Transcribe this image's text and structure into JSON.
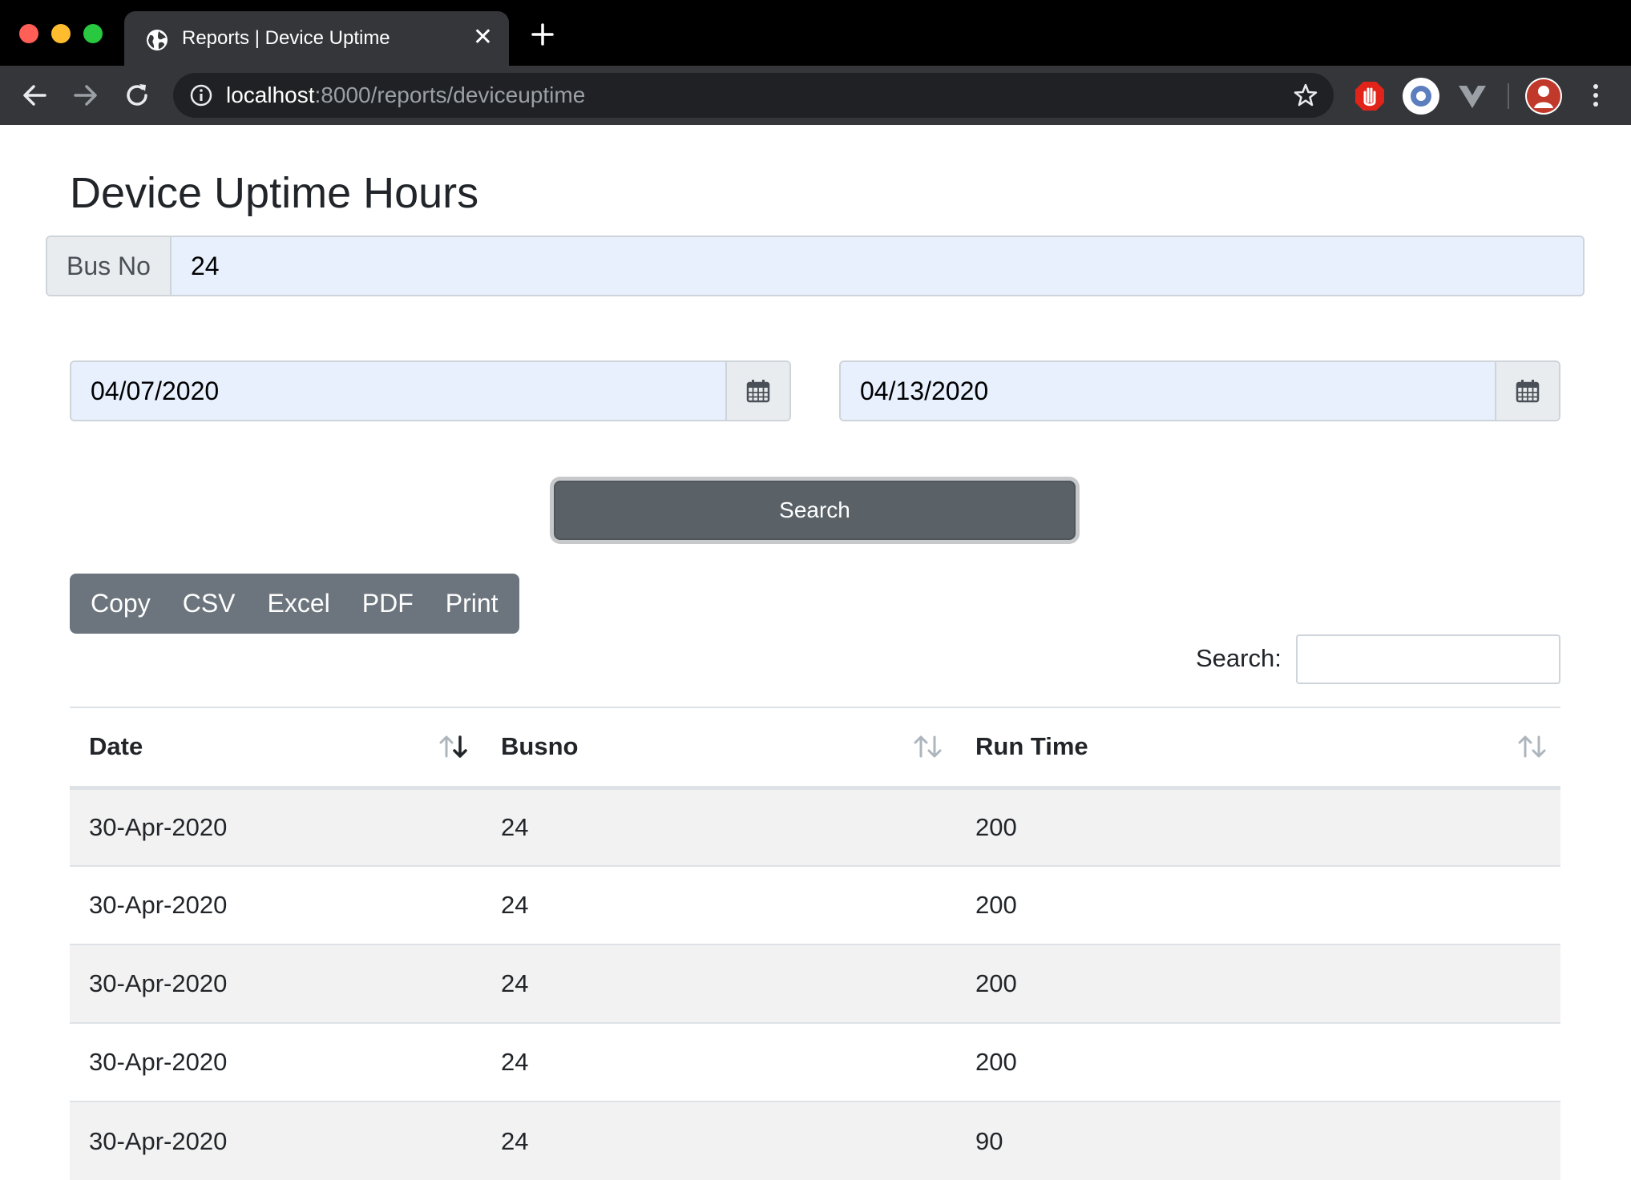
{
  "browser": {
    "tab_title": "Reports | Device Uptime",
    "url_host": "localhost",
    "url_path": ":8000/reports/deviceuptime"
  },
  "page": {
    "title": "Device Uptime Hours"
  },
  "filters": {
    "bus_no_label": "Bus No",
    "bus_no_value": "24",
    "start_date": "04/07/2020",
    "end_date": "04/13/2020",
    "search_button": "Search"
  },
  "export_buttons": [
    "Copy",
    "CSV",
    "Excel",
    "PDF",
    "Print"
  ],
  "table_search": {
    "label": "Search:",
    "value": ""
  },
  "table": {
    "columns": [
      "Date",
      "Busno",
      "Run Time"
    ],
    "rows": [
      [
        "30-Apr-2020",
        "24",
        "200"
      ],
      [
        "30-Apr-2020",
        "24",
        "200"
      ],
      [
        "30-Apr-2020",
        "24",
        "200"
      ],
      [
        "30-Apr-2020",
        "24",
        "200"
      ],
      [
        "30-Apr-2020",
        "24",
        "90"
      ]
    ]
  },
  "colors": {
    "chrome_bg": "#000000",
    "toolbar_bg": "#35363a",
    "autofill_bg": "#e8f0fe",
    "secondary_btn": "#6c757d",
    "stripe": "#f2f2f2"
  }
}
